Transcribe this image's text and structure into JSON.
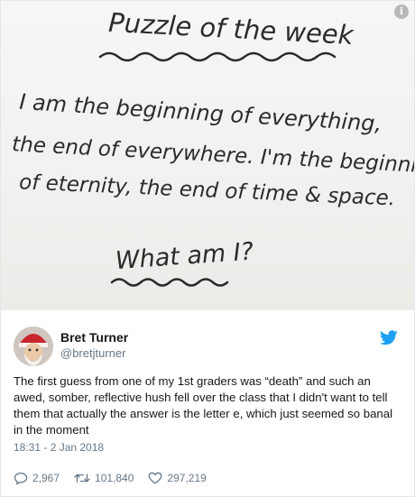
{
  "photo": {
    "heading": "Puzzle of the week",
    "riddle_lines": [
      "I am the beginning of everything,",
      "the end of everywhere. I'm the beginning",
      "of eternity, the end of time & space."
    ],
    "question": "What am I?",
    "info_icon": "info-icon"
  },
  "tweet": {
    "author_name": "Bret Turner",
    "author_handle": "@bretjturner",
    "text": "The first guess from one of my 1st graders was “death” and such an awed, somber, reflective hush fell over the class that I didn't want to tell them that actually the answer is the letter e, which just seemed so banal in the moment",
    "timestamp": "18:31 - 2 Jan 2018",
    "replies": "2,967",
    "retweets": "101,840",
    "likes": "297,219",
    "brand_color": "#1da1f2"
  }
}
